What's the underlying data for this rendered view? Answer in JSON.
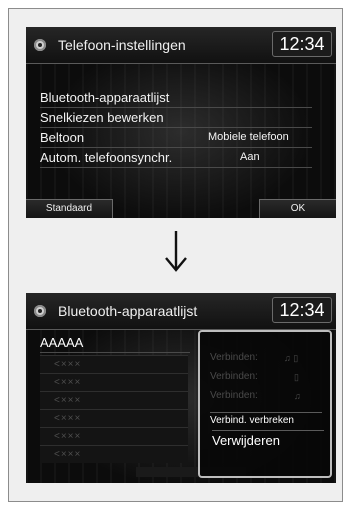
{
  "screen1": {
    "title": "Telefoon-instellingen",
    "clock": "12:34",
    "rows": [
      {
        "label": "Bluetooth-apparaatlijst",
        "value": ""
      },
      {
        "label": "Snelkiezen bewerken",
        "value": ""
      },
      {
        "label": "Beltoon",
        "value": "Mobiele telefoon"
      },
      {
        "label": "Autom. telefoonsynchr.",
        "value": "Aan"
      }
    ],
    "softkeys": {
      "left": "Standaard",
      "right": "OK"
    }
  },
  "arrow_icon": "down-arrow",
  "screen2": {
    "title": "Bluetooth-apparaatlijst",
    "clock": "12:34",
    "first_device": "AAAAA",
    "placeholder_devices": [
      "<×××",
      "<×××",
      "<×××",
      "<×××",
      "<×××",
      "<×××"
    ],
    "popup": {
      "items": [
        {
          "label": "Verbinden:",
          "icon": "♫ ▯",
          "enabled": false
        },
        {
          "label": "Verbinden:",
          "icon": "▯",
          "enabled": false
        },
        {
          "label": "Verbinden:",
          "icon": "♫",
          "enabled": false
        },
        {
          "label": "Verbind. verbreken",
          "icon": "",
          "enabled": true
        },
        {
          "label": "Verwijderen",
          "icon": "",
          "enabled": true
        }
      ]
    }
  }
}
